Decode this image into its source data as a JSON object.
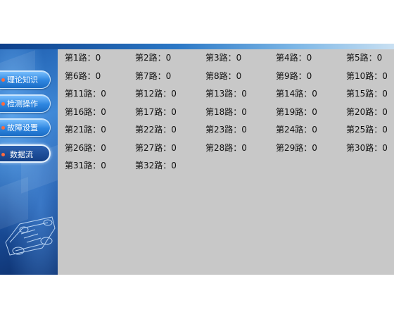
{
  "sidebar": {
    "items": [
      {
        "label": "理论知识",
        "active": false
      },
      {
        "label": "检测操作",
        "active": false
      },
      {
        "label": "故障设置",
        "active": false
      },
      {
        "label": "数据流",
        "active": true
      }
    ]
  },
  "channel_separator": "：",
  "channels": [
    {
      "name": "第1路",
      "value": "0"
    },
    {
      "name": "第2路",
      "value": "0"
    },
    {
      "name": "第3路",
      "value": "0"
    },
    {
      "name": "第4路",
      "value": "0"
    },
    {
      "name": "第5路",
      "value": "0"
    },
    {
      "name": "第6路",
      "value": "0"
    },
    {
      "name": "第7路",
      "value": "0"
    },
    {
      "name": "第8路",
      "value": "0"
    },
    {
      "name": "第9路",
      "value": "0"
    },
    {
      "name": "第10路",
      "value": "0"
    },
    {
      "name": "第11路",
      "value": "0"
    },
    {
      "name": "第12路",
      "value": "0"
    },
    {
      "name": "第13路",
      "value": "0"
    },
    {
      "name": "第14路",
      "value": "0"
    },
    {
      "name": "第15路",
      "value": "0"
    },
    {
      "name": "第16路",
      "value": "0"
    },
    {
      "name": "第17路",
      "value": "0"
    },
    {
      "name": "第18路",
      "value": "0"
    },
    {
      "name": "第19路",
      "value": "0"
    },
    {
      "name": "第20路",
      "value": "0"
    },
    {
      "name": "第21路",
      "value": "0"
    },
    {
      "name": "第22路",
      "value": "0"
    },
    {
      "name": "第23路",
      "value": "0"
    },
    {
      "name": "第24路",
      "value": "0"
    },
    {
      "name": "第25路",
      "value": "0"
    },
    {
      "name": "第26路",
      "value": "0"
    },
    {
      "name": "第27路",
      "value": "0"
    },
    {
      "name": "第28路",
      "value": "0"
    },
    {
      "name": "第29路",
      "value": "0"
    },
    {
      "name": "第30路",
      "value": "0"
    },
    {
      "name": "第31路",
      "value": "0"
    },
    {
      "name": "第32路",
      "value": "0"
    }
  ]
}
